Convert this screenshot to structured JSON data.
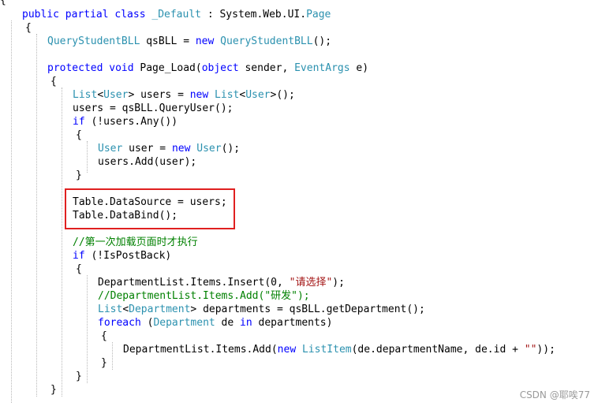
{
  "code_lines": [
    [
      {
        "t": "{",
        "c": "pl"
      }
    ],
    [
      {
        "t": "public partial class ",
        "c": "kw"
      },
      {
        "t": "_Default",
        "c": "ty"
      },
      {
        "t": " : System.Web.UI.",
        "c": "pl"
      },
      {
        "t": "Page",
        "c": "ty"
      }
    ],
    [
      {
        "t": "{",
        "c": "pl"
      }
    ],
    [
      {
        "t": "QueryStudentBLL",
        "c": "ty"
      },
      {
        "t": " qsBLL = ",
        "c": "pl"
      },
      {
        "t": "new ",
        "c": "kw"
      },
      {
        "t": "QueryStudentBLL",
        "c": "ty"
      },
      {
        "t": "();",
        "c": "pl"
      }
    ],
    [],
    [
      {
        "t": "protected void ",
        "c": "kw"
      },
      {
        "t": "Page_Load(",
        "c": "pl"
      },
      {
        "t": "object",
        "c": "kw"
      },
      {
        "t": " sender, ",
        "c": "pl"
      },
      {
        "t": "EventArgs",
        "c": "ty"
      },
      {
        "t": " e)",
        "c": "pl"
      }
    ],
    [
      {
        "t": "{",
        "c": "pl"
      }
    ],
    [
      {
        "t": "List",
        "c": "ty"
      },
      {
        "t": "<",
        "c": "pl"
      },
      {
        "t": "User",
        "c": "ty"
      },
      {
        "t": "> users = ",
        "c": "pl"
      },
      {
        "t": "new ",
        "c": "kw"
      },
      {
        "t": "List",
        "c": "ty"
      },
      {
        "t": "<",
        "c": "pl"
      },
      {
        "t": "User",
        "c": "ty"
      },
      {
        "t": ">();",
        "c": "pl"
      }
    ],
    [
      {
        "t": "users = qsBLL.QueryUser();",
        "c": "pl"
      }
    ],
    [
      {
        "t": "if",
        "c": "kw"
      },
      {
        "t": " (!users.Any())",
        "c": "pl"
      }
    ],
    [
      {
        "t": "{",
        "c": "pl"
      }
    ],
    [
      {
        "t": "User",
        "c": "ty"
      },
      {
        "t": " user = ",
        "c": "pl"
      },
      {
        "t": "new ",
        "c": "kw"
      },
      {
        "t": "User",
        "c": "ty"
      },
      {
        "t": "();",
        "c": "pl"
      }
    ],
    [
      {
        "t": "users.Add(user);",
        "c": "pl"
      }
    ],
    [
      {
        "t": "}",
        "c": "pl"
      }
    ],
    [],
    [
      {
        "t": "Table.DataSource = users;",
        "c": "pl"
      }
    ],
    [
      {
        "t": "Table.DataBind();",
        "c": "pl"
      }
    ],
    [],
    [
      {
        "t": "//第一次加载页面时才执行",
        "c": "cm"
      }
    ],
    [
      {
        "t": "if",
        "c": "kw"
      },
      {
        "t": " (!IsPostBack)",
        "c": "pl"
      }
    ],
    [
      {
        "t": "{",
        "c": "pl"
      }
    ],
    [
      {
        "t": "DepartmentList.Items.Insert(0, ",
        "c": "pl"
      },
      {
        "t": "\"请选择\"",
        "c": "st"
      },
      {
        "t": ");",
        "c": "pl"
      }
    ],
    [
      {
        "t": "//DepartmentList.Items.Add(\"研发\");",
        "c": "cm"
      }
    ],
    [
      {
        "t": "List",
        "c": "ty"
      },
      {
        "t": "<",
        "c": "pl"
      },
      {
        "t": "Department",
        "c": "ty"
      },
      {
        "t": "> departments = qsBLL.getDepartment();",
        "c": "pl"
      }
    ],
    [
      {
        "t": "foreach",
        "c": "kw"
      },
      {
        "t": " (",
        "c": "pl"
      },
      {
        "t": "Department",
        "c": "ty"
      },
      {
        "t": " de ",
        "c": "pl"
      },
      {
        "t": "in",
        "c": "kw"
      },
      {
        "t": " departments)",
        "c": "pl"
      }
    ],
    [
      {
        "t": "{",
        "c": "pl"
      }
    ],
    [
      {
        "t": "DepartmentList.Items.Add(",
        "c": "pl"
      },
      {
        "t": "new ",
        "c": "kw"
      },
      {
        "t": "ListItem",
        "c": "ty"
      },
      {
        "t": "(de.departmentName, de.id + ",
        "c": "pl"
      },
      {
        "t": "\"\"",
        "c": "st"
      },
      {
        "t": "));",
        "c": "pl"
      }
    ],
    [
      {
        "t": "}",
        "c": "pl"
      }
    ],
    [
      {
        "t": "}",
        "c": "pl"
      }
    ],
    [
      {
        "t": "}",
        "c": "pl"
      }
    ]
  ],
  "watermark": "CSDN @耶唉77",
  "colors": {
    "keyword": "#0000ff",
    "type": "#2b91af",
    "comment": "#008000",
    "string": "#a31515",
    "highlight_border": "#e02020"
  }
}
